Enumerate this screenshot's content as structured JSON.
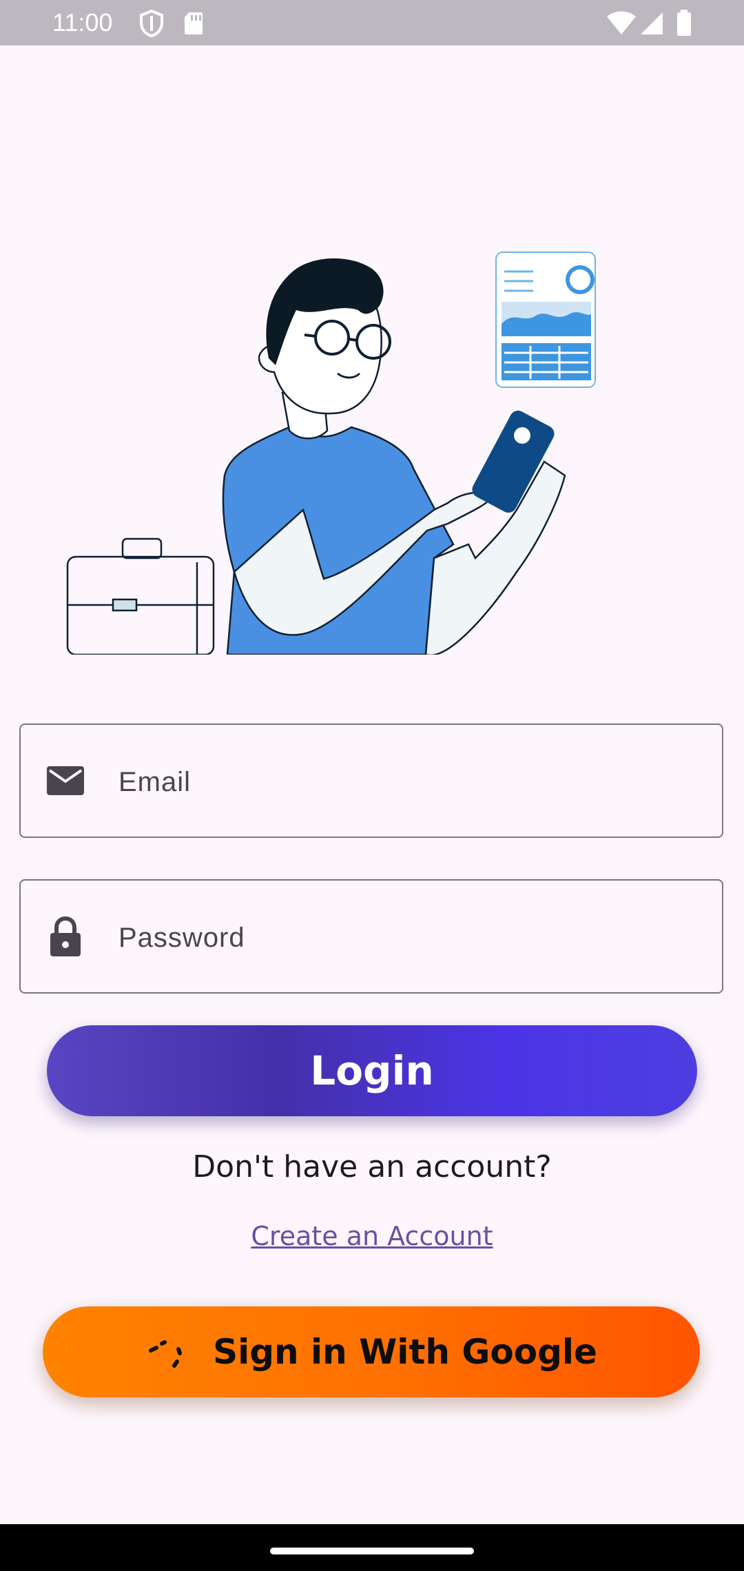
{
  "status_bar": {
    "time": "11:00",
    "icons": [
      "shield-icon",
      "sd-card-icon",
      "wifi-icon",
      "cellular-signal-icon",
      "battery-icon"
    ]
  },
  "illustration": {
    "description_icon": "person-with-phone-illustration"
  },
  "form": {
    "email": {
      "placeholder": "Email",
      "value": "",
      "icon": "mail-icon"
    },
    "password": {
      "placeholder": "Password",
      "value": "",
      "icon": "lock-icon"
    }
  },
  "login_button": {
    "label": "Login",
    "gradient": [
      "#5a45c2",
      "#4430a8",
      "#4c34e6"
    ]
  },
  "signup": {
    "prompt": "Don't have an account?",
    "link": "Create an Account",
    "link_color": "#6750a4"
  },
  "google_button": {
    "label": "Sign in With Google",
    "icon": "loading-spinner-icon",
    "gradient": [
      "#ff8200",
      "#ff5500"
    ]
  }
}
